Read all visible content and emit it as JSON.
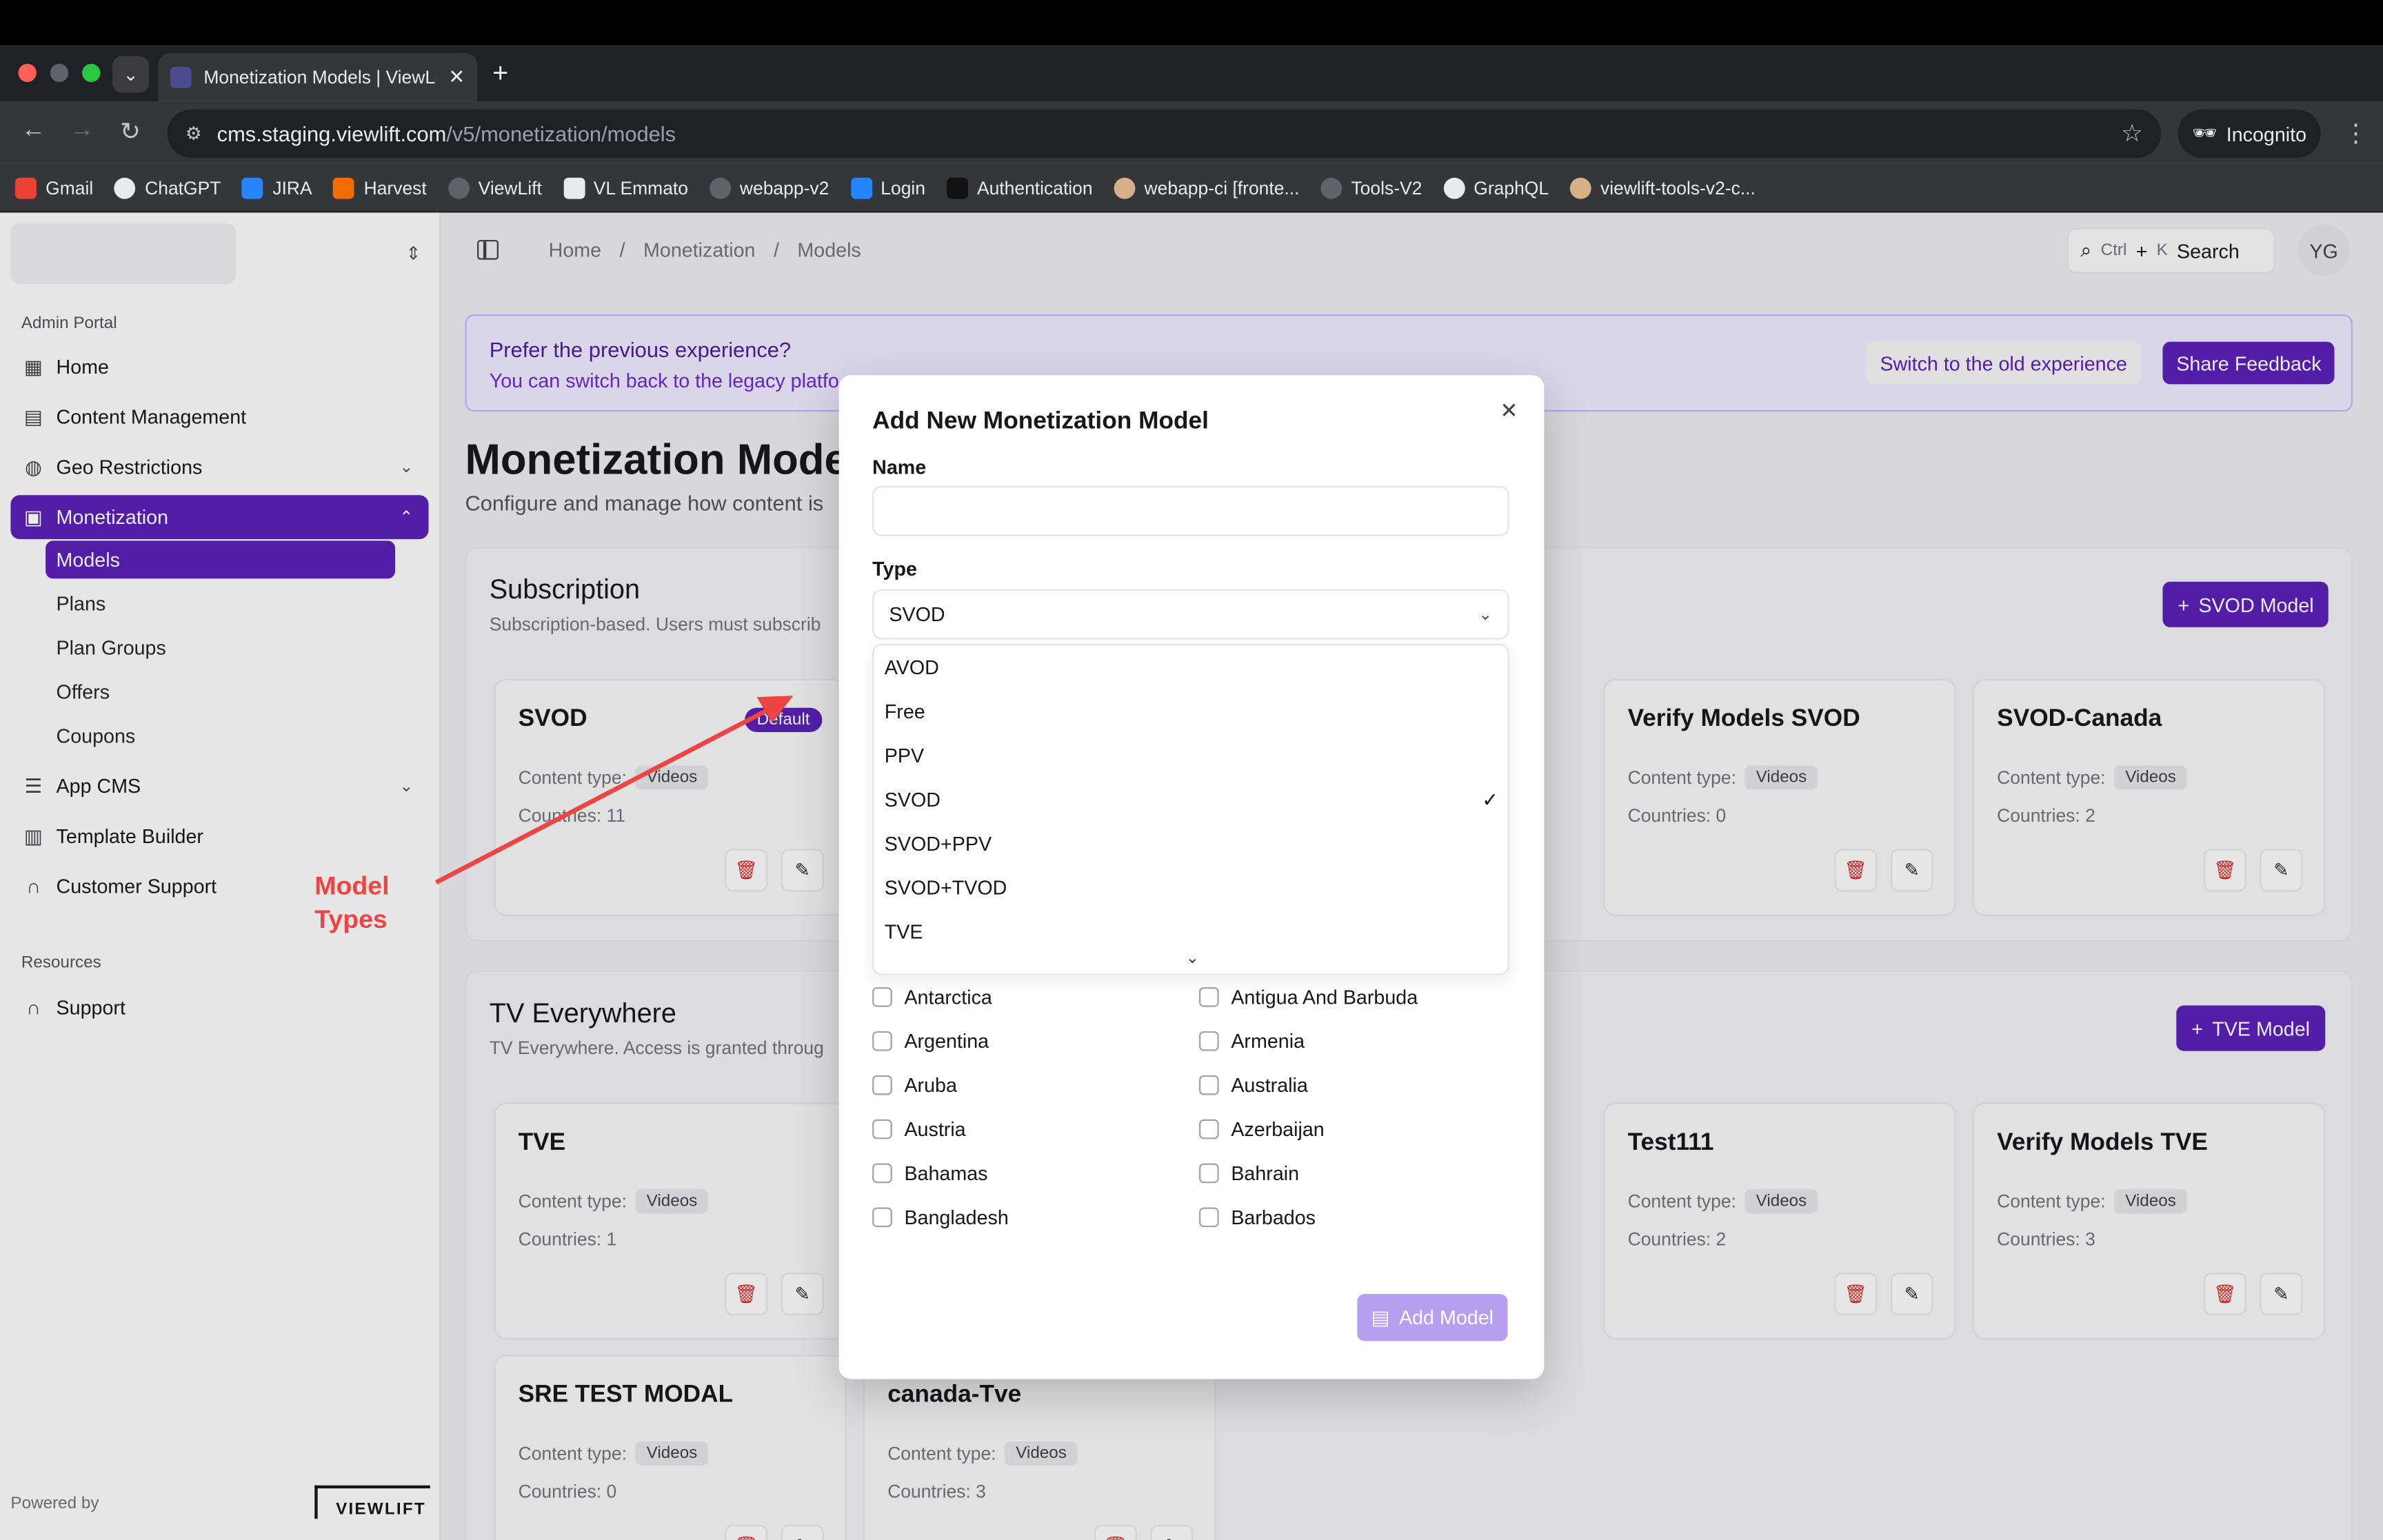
{
  "browser": {
    "tab_title": "Monetization Models | ViewLift",
    "url_host": "cms.staging.viewlift.com",
    "url_path": "/v5/monetization/models",
    "incognito_label": "Incognito",
    "bookmarks": [
      "Gmail",
      "ChatGPT",
      "JIRA",
      "Harvest",
      "ViewLift",
      "VL Emmato",
      "webapp-v2",
      "Login",
      "Authentication",
      "webapp-ci [fronte...",
      "Tools-V2",
      "GraphQL",
      "viewlift-tools-v2-c..."
    ]
  },
  "sidebar": {
    "section_label": "Admin Portal",
    "items": [
      {
        "label": "Home",
        "icon": "grid-icon"
      },
      {
        "label": "Content Management",
        "icon": "film-icon"
      },
      {
        "label": "Geo Restrictions",
        "icon": "globe-icon"
      },
      {
        "label": "Monetization",
        "icon": "wallet-icon"
      },
      {
        "label": "App CMS",
        "icon": "sliders-icon"
      },
      {
        "label": "Template Builder",
        "icon": "layout-icon"
      },
      {
        "label": "Customer Support",
        "icon": "headphones-icon"
      }
    ],
    "sub_items": [
      "Models",
      "Plans",
      "Plan Groups",
      "Offers",
      "Coupons"
    ],
    "resources_label": "Resources",
    "support_label": "Support",
    "powered_by": "Powered by",
    "logo_text": "VIEWLIFT"
  },
  "header": {
    "breadcrumbs": [
      "Home",
      "/",
      "Monetization",
      "/",
      "Models"
    ],
    "search_kbd1": "Ctrl",
    "search_plus": "+",
    "search_kbd2": "K",
    "search_label": "Search",
    "avatar_initials": "YG"
  },
  "banner": {
    "title": "Prefer the previous experience?",
    "subtitle": "You can switch back to the legacy platfo",
    "old_button": "Switch to the old experience",
    "share_button": "Share Feedback"
  },
  "page": {
    "title": "Monetization Model",
    "subtitle": "Configure and manage how content is"
  },
  "subscription": {
    "title": "Subscription",
    "subtitle": "Subscription-based. Users must subscrib",
    "add_button": "SVOD Model",
    "cards": [
      {
        "title": "SVOD",
        "content_type_label": "Content type:",
        "content_type": "Videos",
        "countries": "Countries: 11",
        "badge": "Default"
      },
      {
        "title": "Verify Models SVOD",
        "content_type_label": "Content type:",
        "content_type": "Videos",
        "countries": "Countries: 0"
      },
      {
        "title": "SVOD-Canada",
        "content_type_label": "Content type:",
        "content_type": "Videos",
        "countries": "Countries: 2"
      }
    ]
  },
  "tve": {
    "title": "TV Everywhere",
    "subtitle": "TV Everywhere. Access is granted throug",
    "add_button": "TVE Model",
    "cards": [
      {
        "title": "TVE",
        "content_type_label": "Content type:",
        "content_type": "Videos",
        "countries": "Countries: 1"
      },
      {
        "title": "Test111",
        "content_type_label": "Content type:",
        "content_type": "Videos",
        "countries": "Countries: 2"
      },
      {
        "title": "Verify Models TVE",
        "content_type_label": "Content type:",
        "content_type": "Videos",
        "countries": "Countries: 3"
      },
      {
        "title": "SRE TEST MODAL",
        "content_type_label": "Content type:",
        "content_type": "Videos",
        "countries": "Countries: 0"
      },
      {
        "title": "canada-Tve",
        "content_type_label": "Content type:",
        "content_type": "Videos",
        "countries": "Countries: 3"
      }
    ]
  },
  "modal": {
    "title": "Add New Monetization Model",
    "name_label": "Name",
    "name_value": "",
    "type_label": "Type",
    "type_value": "SVOD",
    "options": [
      "AVOD",
      "Free",
      "PPV",
      "SVOD",
      "SVOD+PPV",
      "SVOD+TVOD",
      "TVE"
    ],
    "selected_option": "SVOD",
    "countries": [
      "Antarctica",
      "Antigua And Barbuda",
      "Argentina",
      "Armenia",
      "Aruba",
      "Australia",
      "Austria",
      "Azerbaijan",
      "Bahamas",
      "Bahrain",
      "Bangladesh",
      "Barbados"
    ],
    "submit_label": "Add Model"
  },
  "annotation": {
    "text_line1": "Model",
    "text_line2": "Types",
    "color": "#ef4444"
  },
  "colors": {
    "accent": "#5b21b6",
    "danger": "#dc2626"
  }
}
